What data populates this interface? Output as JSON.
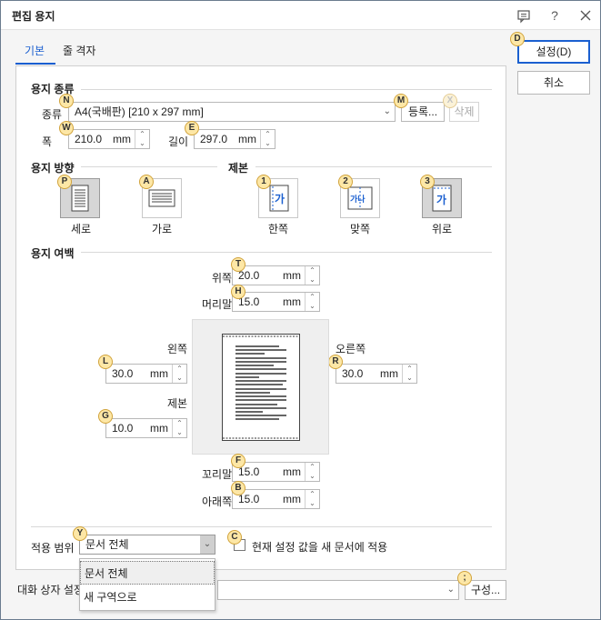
{
  "window": {
    "title": "편집 용지",
    "icons": [
      "comment-icon",
      "help-icon",
      "close-icon"
    ]
  },
  "tabs": [
    {
      "label": "기본",
      "active": true
    },
    {
      "label": "줄 격자",
      "active": false
    }
  ],
  "buttons": {
    "ok": "설정(D)",
    "ok_hotkey_badge": "D",
    "cancel": "취소"
  },
  "paper_kind": {
    "section": "용지 종류",
    "kind_label": "종류",
    "kind_value": "A4(국배판) [210 x 297 mm]",
    "register_button": "등록...",
    "delete_button": "삭제",
    "width_label": "폭",
    "width_value": "210.0",
    "height_label": "길이",
    "height_value": "297.0",
    "unit": "mm",
    "badges": {
      "kind": "N",
      "register": "M",
      "delete": "X",
      "width": "W",
      "height": "E"
    }
  },
  "orientation": {
    "section": "용지 방향",
    "portrait_label": "세로",
    "landscape_label": "가로",
    "selected": "세로",
    "badges": {
      "portrait": "P",
      "landscape": "A"
    }
  },
  "binding": {
    "section": "제본",
    "single_label": "한쪽",
    "facing_label": "맞쪽",
    "top_label": "위로",
    "selected": "위로",
    "glyph": "가",
    "facing_glyph": "가나",
    "badges": {
      "single": "1",
      "facing": "2",
      "top": "3"
    }
  },
  "margins": {
    "section": "용지 여백",
    "unit": "mm",
    "top_label": "위쪽",
    "top_value": "20.0",
    "top_badge": "T",
    "header_label": "머리말",
    "header_value": "15.0",
    "header_badge": "H",
    "left_label": "왼쪽",
    "left_value": "30.0",
    "left_badge": "L",
    "right_label": "오른쪽",
    "right_value": "30.0",
    "right_badge": "R",
    "gutter_label": "제본",
    "gutter_value": "10.0",
    "gutter_badge": "G",
    "footer_label": "꼬리말",
    "footer_value": "15.0",
    "footer_badge": "F",
    "bottom_label": "아래쪽",
    "bottom_value": "15.0",
    "bottom_badge": "B"
  },
  "apply": {
    "range_label": "적용 범위",
    "range_value": "문서 전체",
    "range_badge": "Y",
    "checkbox_label": "현재 설정 값을 새 문서에 적용",
    "checkbox_checked": false,
    "checkbox_badge": "C",
    "options": [
      "문서 전체",
      "새 구역으로"
    ],
    "highlighted_option": "문서 전체"
  },
  "dialog_settings": {
    "label": "대화 상자 설정",
    "config_button": "구성...",
    "config_badge": ";"
  },
  "colors": {
    "accent": "#1a5fd0",
    "badge_fill": "#fde7a6",
    "selected_tile": "#d6d6d6"
  }
}
